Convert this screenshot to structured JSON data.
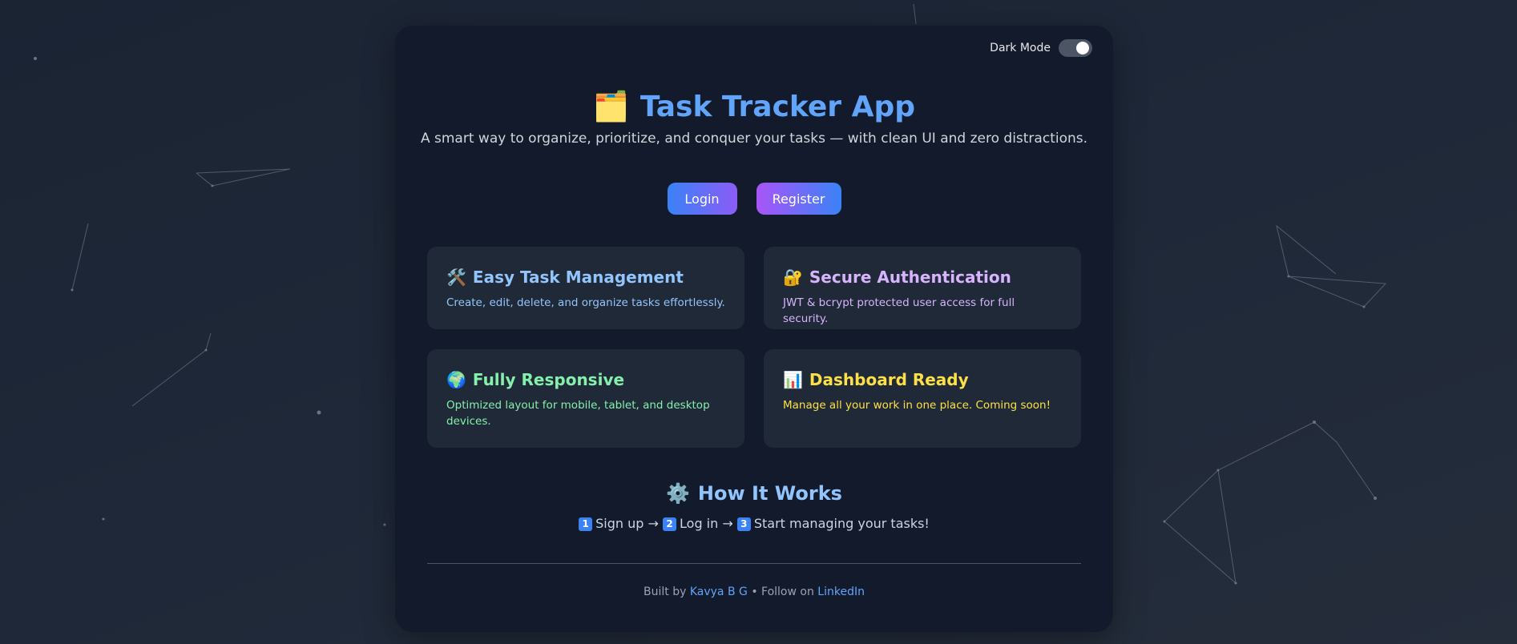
{
  "toggle": {
    "label": "Dark Mode",
    "state": "on"
  },
  "header": {
    "emoji": "🗂️",
    "title": "Task Tracker App",
    "subtitle": "A smart way to organize, prioritize, and conquer your tasks — with clean UI and zero distractions."
  },
  "buttons": {
    "login": "Login",
    "register": "Register"
  },
  "features": [
    {
      "emoji": "🛠️",
      "title": "Easy Task Management",
      "desc": "Create, edit, delete, and organize tasks effortlessly.",
      "color": "#93c5fd"
    },
    {
      "emoji": "🔐",
      "title": "Secure Authentication",
      "desc": "JWT & bcrypt protected user access for full security.",
      "color": "#d8b4fe"
    },
    {
      "emoji": "🌍",
      "title": "Fully Responsive",
      "desc": "Optimized layout for mobile, tablet, and desktop devices.",
      "color": "#86efac"
    },
    {
      "emoji": "📊",
      "title": "Dashboard Ready",
      "desc": "Manage all your work in one place. Coming soon!",
      "color": "#fde047"
    }
  ],
  "how": {
    "emoji": "⚙️",
    "title": "How It Works",
    "step1_num": "1",
    "step1": "Sign up",
    "step2_num": "2",
    "step2": "Log in",
    "step3_num": "3",
    "step3": "Start managing your tasks!",
    "arrow": "→"
  },
  "footer": {
    "prefix": "Built by",
    "author": "Kavya B G",
    "separator": "• Follow on",
    "link": "LinkedIn"
  },
  "colors": {
    "accent": "#60a5fa",
    "card_bg": "#121a2b",
    "feature_bg": "#1f2937"
  }
}
